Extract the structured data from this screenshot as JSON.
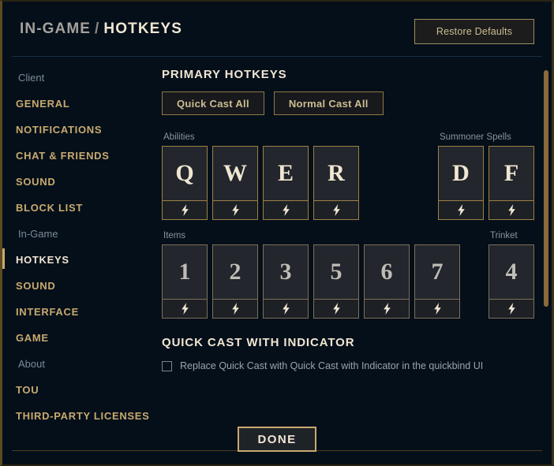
{
  "header": {
    "breadcrumb_parent": "IN-GAME",
    "breadcrumb_separator": "/",
    "breadcrumb_current": "HOTKEYS",
    "restore_defaults_label": "Restore Defaults"
  },
  "sidebar": {
    "groups": [
      {
        "label": "Client",
        "items": [
          {
            "label": "GENERAL",
            "active": false
          },
          {
            "label": "NOTIFICATIONS",
            "active": false
          },
          {
            "label": "CHAT & FRIENDS",
            "active": false
          },
          {
            "label": "SOUND",
            "active": false
          },
          {
            "label": "BLOCK LIST",
            "active": false
          }
        ]
      },
      {
        "label": "In-Game",
        "items": [
          {
            "label": "HOTKEYS",
            "active": true
          },
          {
            "label": "SOUND",
            "active": false
          },
          {
            "label": "INTERFACE",
            "active": false
          },
          {
            "label": "GAME",
            "active": false
          }
        ]
      },
      {
        "label": "About",
        "items": [
          {
            "label": "TOU",
            "active": false
          },
          {
            "label": "THIRD-PARTY LICENSES",
            "active": false
          }
        ]
      }
    ]
  },
  "main": {
    "primary_hotkeys": {
      "title": "PRIMARY HOTKEYS",
      "quick_cast_all_label": "Quick Cast All",
      "normal_cast_all_label": "Normal Cast All",
      "abilities": {
        "label": "Abilities",
        "keys": [
          "Q",
          "W",
          "E",
          "R"
        ]
      },
      "summoner_spells": {
        "label": "Summoner Spells",
        "keys": [
          "D",
          "F"
        ]
      },
      "items": {
        "label": "Items",
        "keys": [
          "1",
          "2",
          "3",
          "5",
          "6",
          "7"
        ]
      },
      "trinket": {
        "label": "Trinket",
        "keys": [
          "4"
        ]
      }
    },
    "quick_cast_with_indicator": {
      "title": "QUICK CAST WITH INDICATOR",
      "checkbox_label": "Replace Quick Cast with Quick Cast with Indicator in the quickbind UI",
      "checked": false
    }
  },
  "footer": {
    "done_label": "DONE"
  },
  "colors": {
    "gold": "#c8aa6e",
    "gold_text": "#cdbe91",
    "cream": "#f0e6d2",
    "background": "#050f1a",
    "key_fill": "#23262c",
    "scrollbar": "#8a6a3b"
  }
}
